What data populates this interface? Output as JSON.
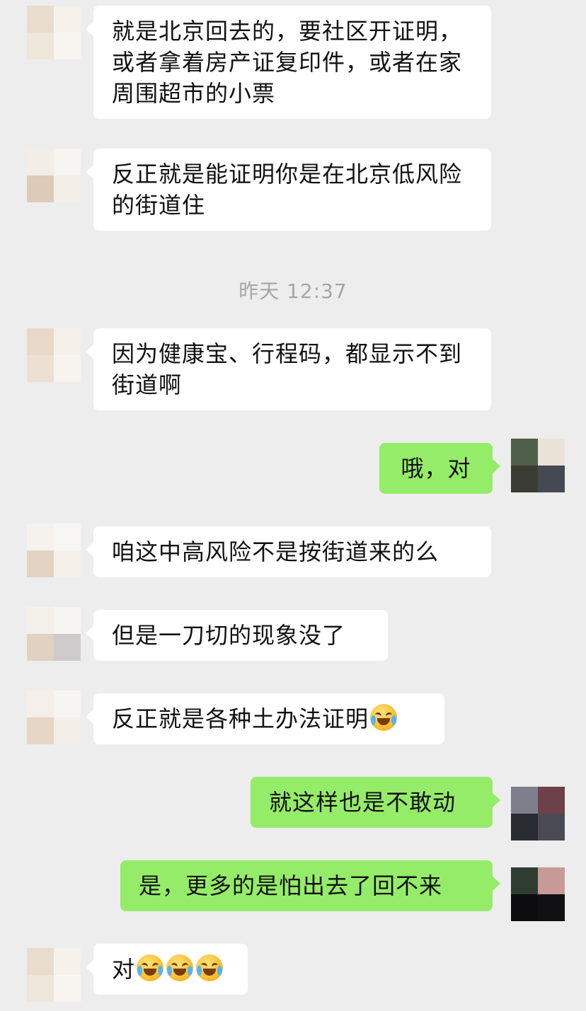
{
  "chat": {
    "messages": [
      {
        "side": "in",
        "text": "就是北京回去的，要社区开证明，或者拿着房产证复印件，或者在家周围超市的小票"
      },
      {
        "side": "in",
        "text": "反正就是能证明你是在北京低风险的街道住"
      },
      {
        "type": "time",
        "text": "昨天 12:37"
      },
      {
        "side": "in",
        "text": "因为健康宝、行程码，都显示不到街道啊"
      },
      {
        "side": "out",
        "text": "哦，对"
      },
      {
        "side": "in",
        "text": "咱这中高风险不是按街道来的么"
      },
      {
        "side": "in",
        "text": "但是一刀切的现象没了"
      },
      {
        "side": "in",
        "text": "反正就是各种土办法证明",
        "emoji": [
          "crying-laughing-emoji"
        ]
      },
      {
        "side": "out",
        "text": "就这样也是不敢动"
      },
      {
        "side": "out",
        "text": "是，更多的是怕出去了回不来"
      },
      {
        "side": "in",
        "text": "对",
        "emoji": [
          "crying-laughing-emoji",
          "crying-laughing-emoji",
          "crying-laughing-emoji"
        ]
      }
    ]
  },
  "colors": {
    "background": "#ededed",
    "incoming_bubble": "#ffffff",
    "outgoing_bubble": "#95ec69",
    "timestamp": "#a6a6a6",
    "avatar_in": [
      "#e6d8c8",
      "#f4efe8",
      "#efe6dc",
      "#f7f4f0"
    ],
    "avatar_out_1": [
      "#4f5f49",
      "#e9e2d6",
      "#3b3d35",
      "#454a52"
    ],
    "avatar_out_2": [
      "#7e7f8c",
      "#6e4049",
      "#2a2c33",
      "#4a4b52"
    ],
    "avatar_out_3": [
      "#2f3d33",
      "#c79a97",
      "#0d0d10",
      "#111114"
    ]
  }
}
